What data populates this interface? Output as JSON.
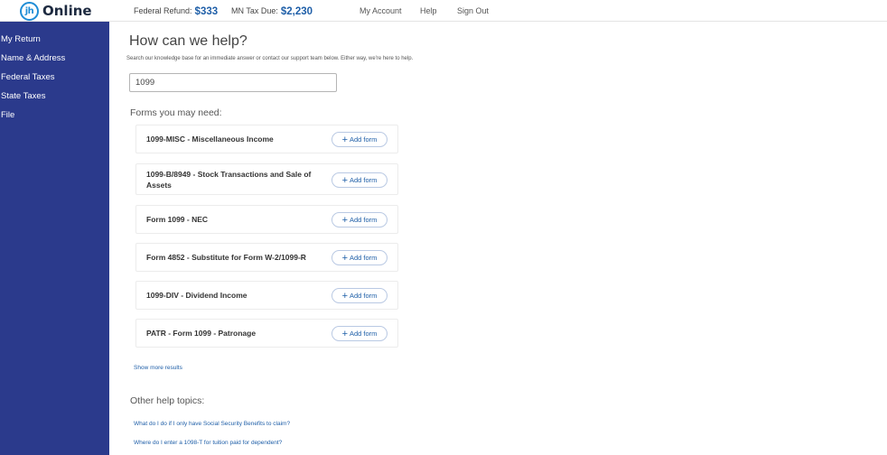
{
  "header": {
    "logo_mark": "jh",
    "logo_text": "Online",
    "federal_refund_label": "Federal Refund:",
    "federal_refund_amount": "$333",
    "mn_tax_label": "MN Tax Due:",
    "mn_tax_amount": "$2,230",
    "nav": [
      "My Account",
      "Help",
      "Sign Out"
    ]
  },
  "sidebar": {
    "items": [
      "My Return",
      "Name & Address",
      "Federal Taxes",
      "State Taxes",
      "File"
    ]
  },
  "main": {
    "title": "How can we help?",
    "subtitle": "Search our knowledge base for an immediate answer or contact our support team below. Either way, we're here to help.",
    "search_value": "1099",
    "forms_heading": "Forms you may need:",
    "add_form_label": "Add form",
    "forms": [
      "1099-MISC - Miscellaneous Income",
      "1099-B/8949 - Stock Transactions and Sale of Assets",
      "Form 1099 - NEC",
      "Form 4852 - Substitute for Form W-2/1099-R",
      "1099-DIV - Dividend Income",
      "PATR - Form 1099 - Patronage"
    ],
    "show_more": "Show more results",
    "other_heading": "Other help topics:",
    "topics": [
      "What do I do if I only have Social Security Benefits to claim?",
      "Where do I enter a 1098-T for tuition paid for dependent?"
    ]
  }
}
